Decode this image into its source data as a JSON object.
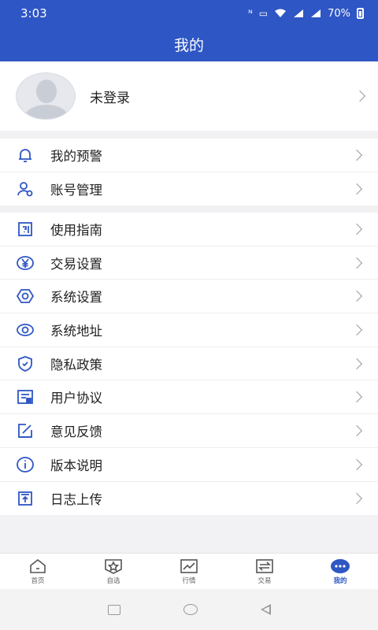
{
  "status": {
    "time": "3:03",
    "battery": "70%",
    "icons": [
      "nfc-icon",
      "hd-icon",
      "wifi-icon",
      "signal-icon",
      "signal-icon",
      "battery-icon"
    ]
  },
  "header": {
    "title": "我的"
  },
  "profile": {
    "name": "未登录"
  },
  "group1": [
    {
      "label": "我的预警",
      "icon": "bell-icon"
    },
    {
      "label": "账号管理",
      "icon": "user-settings-icon"
    }
  ],
  "group2": [
    {
      "label": "使用指南",
      "icon": "guide-icon"
    },
    {
      "label": "交易设置",
      "icon": "yuan-icon"
    },
    {
      "label": "系统设置",
      "icon": "gear-icon"
    },
    {
      "label": "系统地址",
      "icon": "eye-icon"
    },
    {
      "label": "隐私政策",
      "icon": "shield-icon"
    },
    {
      "label": "用户协议",
      "icon": "agreement-icon"
    },
    {
      "label": "意见反馈",
      "icon": "edit-icon"
    },
    {
      "label": "版本说明",
      "icon": "info-icon"
    },
    {
      "label": "日志上传",
      "icon": "upload-icon"
    }
  ],
  "tabs": [
    {
      "label": "首页",
      "icon": "home-icon"
    },
    {
      "label": "自选",
      "icon": "star-icon"
    },
    {
      "label": "行情",
      "icon": "chart-icon"
    },
    {
      "label": "交易",
      "icon": "trade-icon"
    },
    {
      "label": "我的",
      "icon": "mine-icon"
    }
  ],
  "colors": {
    "accent": "#2e56c4",
    "icon_blue": "#2e56c4"
  }
}
